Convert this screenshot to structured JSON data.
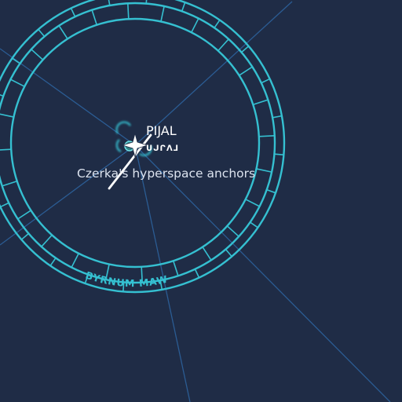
{
  "map": {
    "colors": {
      "background": "#1f2c46",
      "route": "#2b5c93",
      "ring": "#35c0d1",
      "label": "#ffffff",
      "note": "#dce3ef"
    },
    "system": {
      "name": "PIJAL",
      "aurebesh": "ᑌᒍᒋᐱᒧ",
      "note": "Czerka's hyperspace anchors",
      "marker_icon": "star-marker-icon"
    },
    "region": {
      "name": "BYRNUM MAW"
    }
  }
}
